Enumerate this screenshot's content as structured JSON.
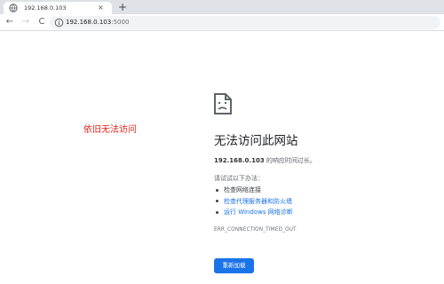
{
  "tab": {
    "title": "192.168.0.103",
    "close": "×",
    "new_tab": "+"
  },
  "toolbar": {
    "back": "←",
    "forward": "→",
    "reload": "C"
  },
  "address": {
    "host": "192.168.0.103",
    "port": ":5000"
  },
  "annotation": {
    "text": "依旧无法访问"
  },
  "error": {
    "title": "无法访问此网站",
    "host": "192.168.0.103",
    "detail_suffix": " 的响应时间过长。",
    "try_label": "请试试以下办法：",
    "suggestions": [
      "检查网络连接",
      "检查代理服务器和防火墙",
      "运行 Windows 网络诊断"
    ],
    "code": "ERR_CONNECTION_TIMED_OUT",
    "reload_label": "重新加载"
  },
  "colors": {
    "link": "#1a73e8",
    "annotation": "#e8221b",
    "button": "#1a73e8"
  }
}
